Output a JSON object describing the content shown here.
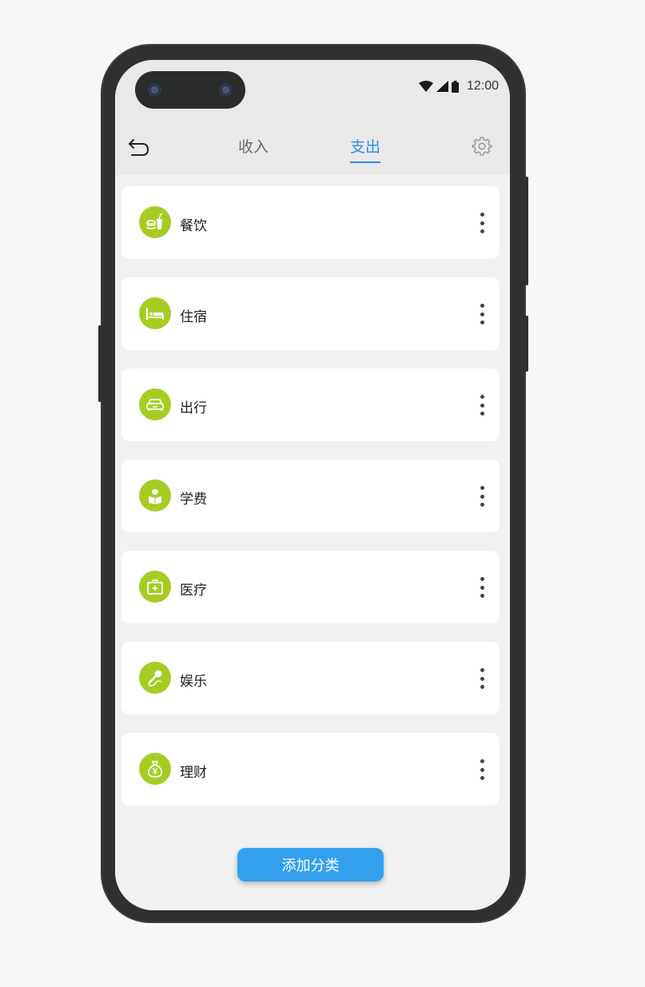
{
  "status_bar": {
    "time": "12:00",
    "icons": [
      "wifi-icon",
      "signal-icon",
      "battery-icon"
    ]
  },
  "header": {
    "back_icon": "back-arrow-icon",
    "tabs": [
      {
        "label": "收入",
        "selected": false
      },
      {
        "label": "支出",
        "selected": true
      }
    ],
    "settings_icon": "gear-icon"
  },
  "categories": [
    {
      "label": "餐饮",
      "icon": "food-drink-icon"
    },
    {
      "label": "住宿",
      "icon": "bed-icon"
    },
    {
      "label": "出行",
      "icon": "car-icon"
    },
    {
      "label": "学费",
      "icon": "student-icon"
    },
    {
      "label": "医疗",
      "icon": "medical-kit-icon"
    },
    {
      "label": "娱乐",
      "icon": "microphone-icon"
    },
    {
      "label": "理财",
      "icon": "money-bag-icon"
    }
  ],
  "add_button": {
    "label": "添加分类"
  },
  "colors": {
    "accent": "#2b8af0",
    "icon_bg": "#a6cc24",
    "add_button": "#33a0ee",
    "background": "#f1f1f1"
  }
}
